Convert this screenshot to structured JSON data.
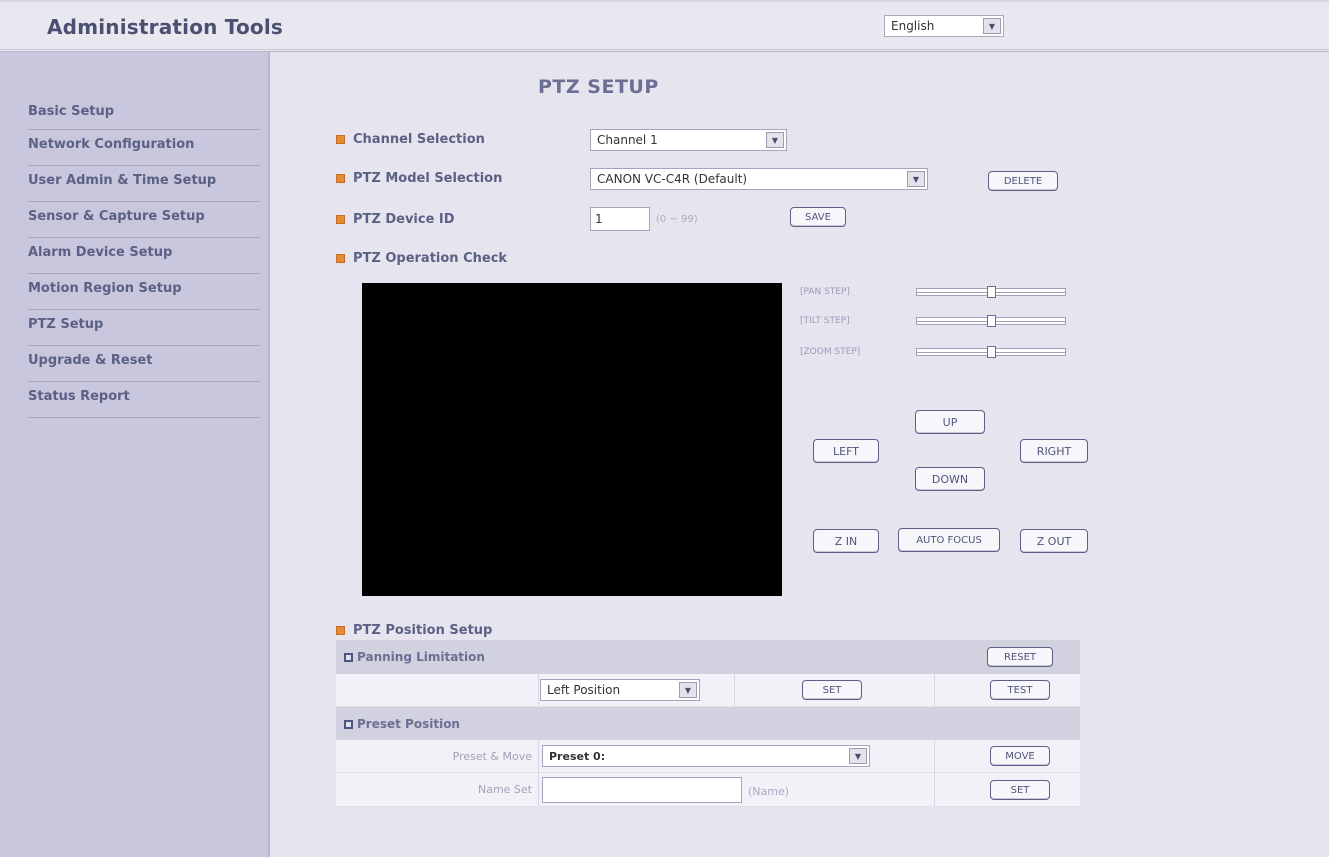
{
  "header": {
    "app_title": "Administration Tools",
    "language": {
      "selected": "English"
    }
  },
  "sidebar": {
    "items": [
      {
        "label": "Basic Setup"
      },
      {
        "label": "Network Configuration"
      },
      {
        "label": "User Admin & Time Setup"
      },
      {
        "label": "Sensor & Capture Setup"
      },
      {
        "label": "Alarm Device Setup"
      },
      {
        "label": "Motion Region Setup"
      },
      {
        "label": "PTZ Setup"
      },
      {
        "label": "Upgrade & Reset"
      },
      {
        "label": "Status Report"
      }
    ]
  },
  "main": {
    "title": "PTZ SETUP",
    "channel": {
      "label": "Channel Selection",
      "selected": "Channel 1"
    },
    "model": {
      "label": "PTZ Model Selection",
      "selected": "CANON VC-C4R (Default)",
      "delete_label": "DELETE"
    },
    "device_id": {
      "label": "PTZ Device ID",
      "value": "1",
      "hint": "(0 ~ 99)",
      "save_label": "SAVE"
    },
    "operation": {
      "label": "PTZ Operation Check",
      "steps": [
        {
          "label": "[PAN STEP]",
          "level": 0.5
        },
        {
          "label": "[TILT STEP]",
          "level": 0.5
        },
        {
          "label": "[ZOOM STEP]",
          "level": 0.5
        }
      ],
      "buttons": {
        "up": "UP",
        "left": "LEFT",
        "right": "RIGHT",
        "down": "DOWN",
        "zoom_in": "Z IN",
        "auto_focus": "AUTO FOCUS",
        "zoom_out": "Z OUT"
      }
    },
    "position": {
      "label": "PTZ Position Setup",
      "panning": {
        "title": "Panning Limitation",
        "reset_label": "RESET",
        "position_selected": "Left Position",
        "set_label": "SET",
        "test_label": "TEST"
      },
      "preset": {
        "title": "Preset Position",
        "move_label_text": "Preset & Move",
        "preset_selected": "Preset 0:",
        "move_label": "MOVE",
        "name_label_text": "Name Set",
        "name_value": "",
        "name_hint": "(Name)",
        "set_label": "SET"
      }
    }
  }
}
